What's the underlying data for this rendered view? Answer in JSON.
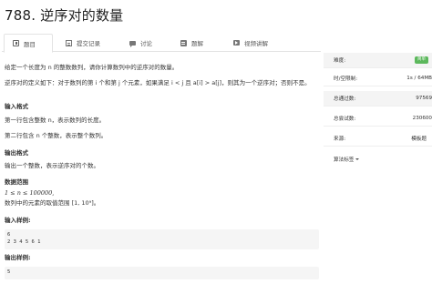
{
  "problem": {
    "title": "788. 逆序对的数量"
  },
  "tabs": [
    {
      "label": "题目",
      "icon": "book-icon",
      "active": true
    },
    {
      "label": "提交记录",
      "icon": "document-icon"
    },
    {
      "label": "讨论",
      "icon": "chat-icon"
    },
    {
      "label": "题解",
      "icon": "solution-icon"
    },
    {
      "label": "视频讲解",
      "icon": "video-icon"
    }
  ],
  "statement": {
    "intro": "给定一个长度为 n 的整数数列，请你计算数列中的逆序对的数量。",
    "definition": "逆序对的定义如下：对于数列的第 i 个和第 j 个元素，如果满足 i < j 且 a[i] > a[j]，则其为一个逆序对；否则不是。",
    "input_heading": "输入格式",
    "input_line1": "第一行包含整数 n，表示数列的长度。",
    "input_line2": "第二行包含 n 个整数，表示整个数列。",
    "output_heading": "输出格式",
    "output_line": "输出一个整数，表示逆序对的个数。",
    "range_heading": "数据范围",
    "range_line1": "1 ≤ n ≤ 100000,",
    "range_line2": "数列中的元素的取值范围 [1, 10⁹]。",
    "sample_input_heading": "输入样例:",
    "sample_input_lines": [
      "6",
      "2 3 4 5 6 1"
    ],
    "sample_output_heading": "输出样例:",
    "sample_output_lines": [
      "5"
    ]
  },
  "sidebar": {
    "difficulty_label": "难度:",
    "difficulty_value": "简单",
    "difficulty_color": "#5cb85c",
    "time_limit_label": "时/空限制:",
    "time_limit_value": "1s / 64MB",
    "total_passed_label": "总通过数:",
    "total_passed_value": "97569",
    "total_attempts_label": "总尝试数:",
    "total_attempts_value": "230600",
    "source_label": "来源:",
    "source_value": "模板题",
    "tags_label": "算法标签"
  }
}
